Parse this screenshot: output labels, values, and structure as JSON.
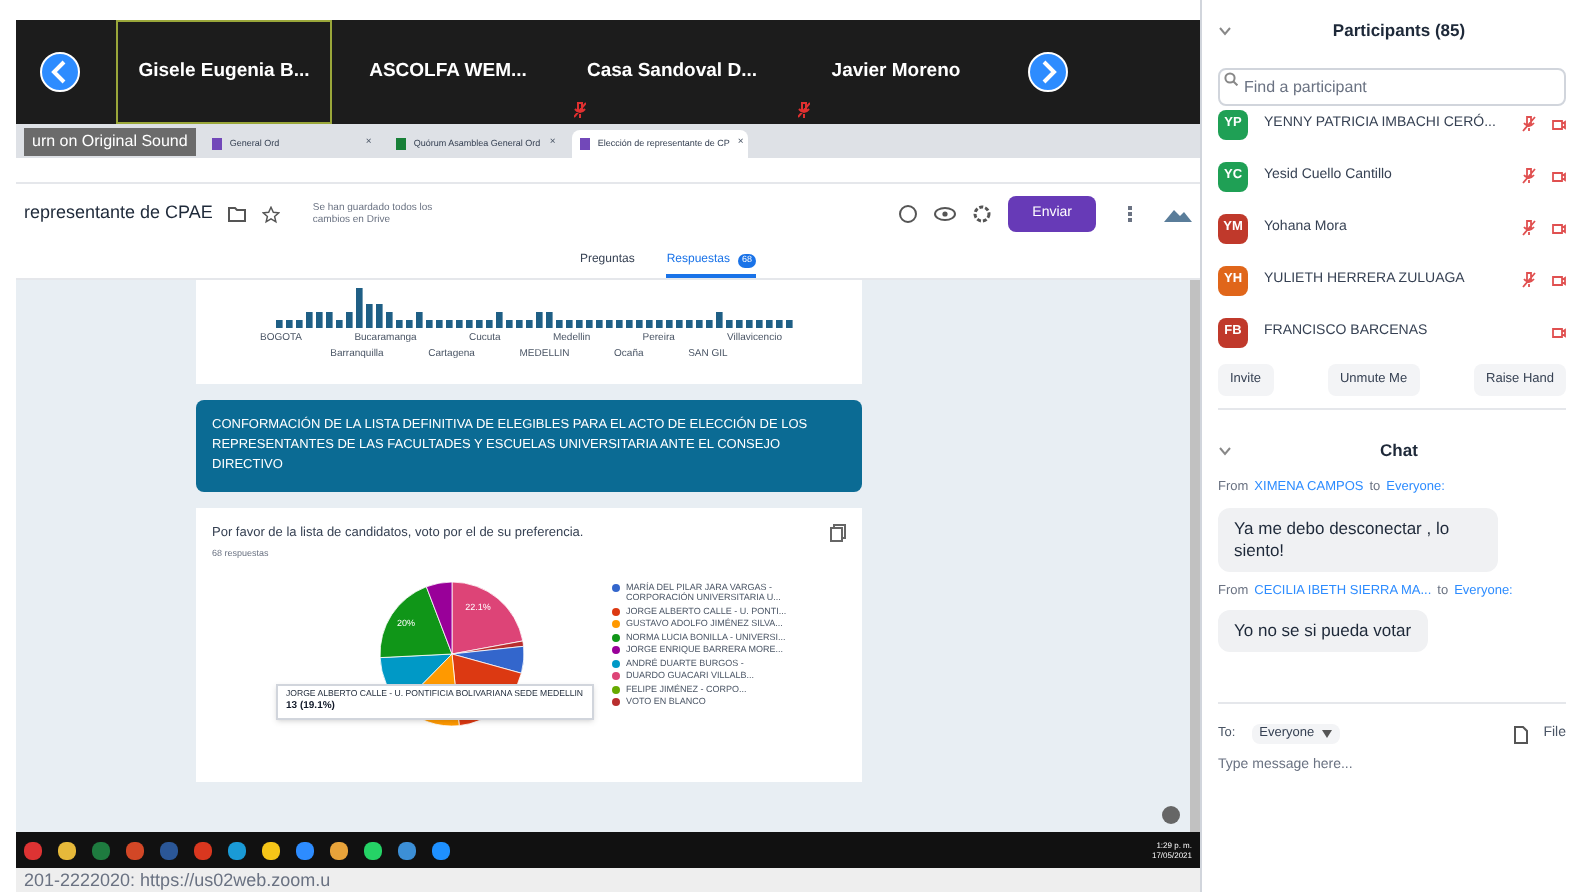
{
  "video_strip": {
    "tiles": [
      {
        "name": "Gisele Eugenia B...",
        "selected": true,
        "muted": false
      },
      {
        "name": "ASCOLFA WEM...",
        "selected": false,
        "muted": false
      },
      {
        "name": "Casa Sandoval D...",
        "selected": false,
        "muted": true
      },
      {
        "name": "Javier Moreno",
        "selected": false,
        "muted": true
      }
    ]
  },
  "original_sound_button": "urn on Original Sound",
  "browser": {
    "tabs": [
      {
        "title": "General Ord",
        "selected": false,
        "kind": "forms",
        "close": "×"
      },
      {
        "title": "Quórum Asamblea General Ord",
        "selected": false,
        "kind": "sheets",
        "close": "×"
      },
      {
        "title": "Elección de representante de CP",
        "selected": true,
        "kind": "forms",
        "close": "×"
      }
    ]
  },
  "form": {
    "title": "representante de CPAE",
    "save_status": "Se han guardado todos los cambios en Drive",
    "send_button": "Enviar",
    "tabs": [
      {
        "label": "Preguntas",
        "selected": false
      },
      {
        "label": "Respuestas",
        "selected": true,
        "badge": "68"
      }
    ],
    "city_labels_top": [
      "BOGOTA",
      "Bucaramanga",
      "Cucuta",
      "Medellin",
      "Pereira",
      "Villavicencio"
    ],
    "city_labels_bottom": [
      "Barranquilla",
      "Cartagena",
      "MEDELLIN",
      "Ocaña",
      "SAN GIL"
    ],
    "section_title": "CONFORMACIÓN DE LA LISTA DEFINITIVA DE ELEGIBLES PARA EL ACTO DE ELECCIÓN DE LOS REPRESENTANTES DE LAS FACULTADES Y ESCUELAS UNIVERSITARIA ANTE EL CONSEJO DIRECTIVO",
    "question": "Por favor de la lista de candidatos, voto por el de su preferencia.",
    "response_count": "68 respuestas",
    "slice_labels": [
      "22.1%",
      "20%"
    ],
    "legend": [
      {
        "label": "MARÍA DEL PILAR JARA VARGAS - CORPORACIÓN UNIVERSITARIA U...",
        "color": "#3366cc"
      },
      {
        "label": "JORGE ALBERTO CALLE - U. PONTI...",
        "color": "#dc3912"
      },
      {
        "label": "GUSTAVO ADOLFO JIMÉNEZ SILVA...",
        "color": "#ff9900"
      },
      {
        "label": "NORMA LUCIA BONILLA - UNIVERSI...",
        "color": "#109618"
      },
      {
        "label": "JORGE ENRIQUE BARRERA MORE...",
        "color": "#990099"
      },
      {
        "label": "ANDRÉ DUARTE BURGOS -",
        "color": "#0099c6"
      },
      {
        "label": "DUARDO GUACARI VILLALB...",
        "color": "#dd4477"
      },
      {
        "label": "FELIPE JIMÉNEZ - CORPO...",
        "color": "#66aa00"
      },
      {
        "label": "VOTO EN BLANCO",
        "color": "#b82e2e"
      }
    ],
    "tooltip": {
      "title": "JORGE ALBERTO CALLE - U. PONTIFICIA BOLIVARIANA SEDE MEDELLIN",
      "value": "13 (19.1%)"
    }
  },
  "taskbar": {
    "time": "1:29 p. m.",
    "date": "17/05/2021"
  },
  "bottom_text": "201-2222020: https://us02web.zoom.u",
  "participants": {
    "title": "Participants (85)",
    "search_placeholder": "Find a participant",
    "items": [
      {
        "initials": "YP",
        "name": "YENNY PATRICIA IMBACHI CERÓ...",
        "color": "#1fa055",
        "muted": true
      },
      {
        "initials": "YC",
        "name": "Yesid Cuello Cantillo",
        "color": "#1fa055",
        "muted": true
      },
      {
        "initials": "YM",
        "name": "Yohana Mora",
        "color": "#c0392b",
        "muted": true
      },
      {
        "initials": "YH",
        "name": "YULIETH HERRERA ZULUAGA",
        "color": "#e0661a",
        "muted": true
      },
      {
        "initials": "FB",
        "name": "FRANCISCO BARCENAS",
        "color": "#c0392b",
        "muted": false
      }
    ],
    "buttons": [
      "Invite",
      "Unmute Me",
      "Raise Hand"
    ]
  },
  "chat": {
    "title": "Chat",
    "messages": [
      {
        "prefix": "From",
        "from": "XIMENA CAMPOS",
        "joiner": "to",
        "to": "Everyone:",
        "text": "Ya me debo desconectar , lo siento!"
      },
      {
        "prefix": "From",
        "from": "CECILIA IBETH SIERRA MA...",
        "joiner": "to",
        "to": "Everyone:",
        "text": "Yo no se si pueda votar"
      }
    ],
    "to_label": "To:",
    "recipient": "Everyone",
    "file_button": "File",
    "placeholder": "Type message here..."
  }
}
